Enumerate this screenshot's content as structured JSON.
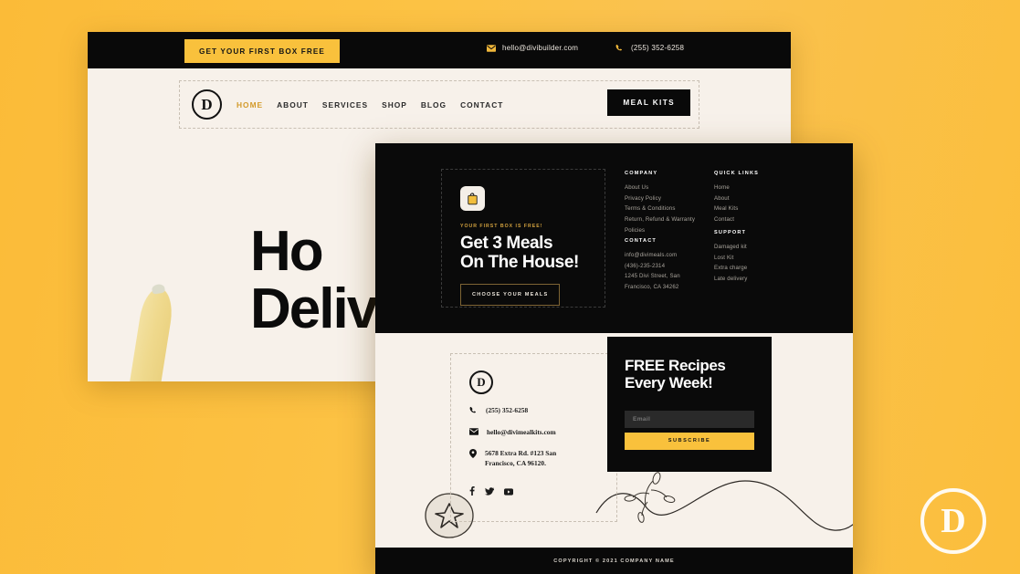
{
  "background_page": {
    "topbar": {
      "cta_label": "GET YOUR FIRST BOX FREE",
      "email": "hello@divibuilder.com",
      "phone": "(255) 352-6258",
      "email_icon": "envelope-icon",
      "phone_icon": "phone-icon"
    },
    "nav": {
      "logo": "D",
      "items": [
        {
          "label": "HOME",
          "active": true
        },
        {
          "label": "ABOUT",
          "active": false
        },
        {
          "label": "SERVICES",
          "active": false
        },
        {
          "label": "SHOP",
          "active": false
        },
        {
          "label": "BLOG",
          "active": false
        },
        {
          "label": "CONTACT",
          "active": false
        }
      ],
      "button_label": "MEAL KITS"
    },
    "hero": {
      "line1": "Ho",
      "line2": "Deliv"
    }
  },
  "footer_page": {
    "cta": {
      "icon": "gift-bag-icon",
      "eyebrow": "YOUR FIRST BOX IS FREE!",
      "heading_line1": "Get 3 Meals",
      "heading_line2": "On The House!",
      "button_label": "CHOOSE YOUR MEALS"
    },
    "columns": {
      "company": {
        "title": "COMPANY",
        "items": [
          "About Us",
          "Privacy Policy",
          "Terms & Conditions",
          "Return, Refund & Warranty",
          "Policies"
        ]
      },
      "contact": {
        "title": "CONTACT",
        "items": [
          "info@divimeals.com",
          "(436)-235-2314",
          "1245 Divi Street, San",
          "Francisco, CA 34262"
        ]
      },
      "quick_links": {
        "title": "QUICK LINKS",
        "items": [
          "Home",
          "About",
          "Meal Kits",
          "Contact"
        ]
      },
      "support": {
        "title": "SUPPORT",
        "items": [
          "Damaged kit",
          "Lost Kit",
          "Extra charge",
          "Late delivery"
        ]
      }
    },
    "info": {
      "logo": "D",
      "phone": "(255) 352-6258",
      "email": "hello@divimealkits.com",
      "address_line1": "5678 Extra Rd. #123 San",
      "address_line2": "Francisco, CA 96120.",
      "phone_icon": "phone-icon",
      "email_icon": "envelope-icon",
      "location_icon": "map-pin-icon",
      "socials": [
        "facebook-icon",
        "twitter-icon",
        "youtube-icon"
      ]
    },
    "newsletter": {
      "heading_line1": "FREE Recipes",
      "heading_line2": "Every Week!",
      "input_placeholder": "Email",
      "input_value": "",
      "button_label": "SUBSCRIBE"
    },
    "copyright": "COPYRIGHT © 2021 COMPANY NAME"
  },
  "watermark": {
    "letter": "D"
  },
  "colors": {
    "brand_yellow": "#F9C13C",
    "dark": "#0A0A0A",
    "cream": "#F7F1EA",
    "accent_gold": "#D39A2A",
    "muted_text": "#A9A49C"
  }
}
